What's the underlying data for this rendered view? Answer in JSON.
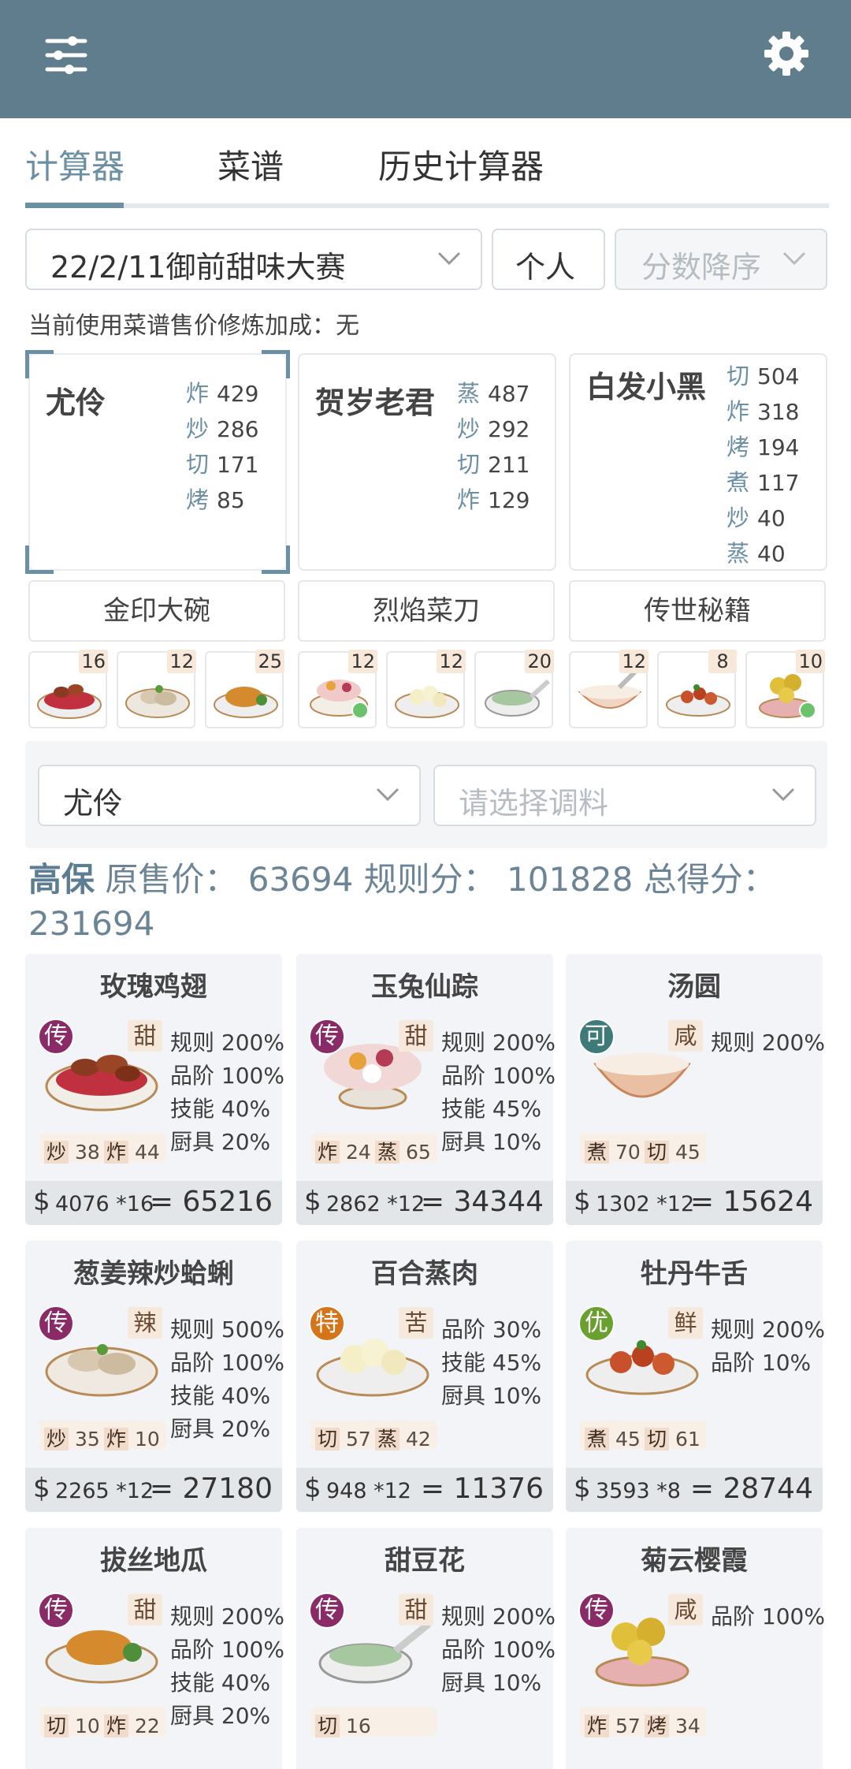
{
  "colors": {
    "header": "#5f7d8d",
    "accent": "#6b8fa3"
  },
  "tabs": [
    "计算器",
    "菜谱",
    "历史计算器"
  ],
  "filters": {
    "contest": "22/2/11御前甜味大赛",
    "mode": "个人",
    "sort": "分数降序"
  },
  "bonus_text": "当前使用菜谱售价修炼加成：无",
  "chefs": [
    {
      "name": "尤伶",
      "skills": [
        [
          "炸",
          "429"
        ],
        [
          "炒",
          "286"
        ],
        [
          "切",
          "171"
        ],
        [
          "烤",
          "85"
        ]
      ]
    },
    {
      "name": "贺岁老君",
      "skills": [
        [
          "蒸",
          "487"
        ],
        [
          "炒",
          "292"
        ],
        [
          "切",
          "211"
        ],
        [
          "炸",
          "129"
        ]
      ]
    },
    {
      "name": "白发小黑",
      "skills": [
        [
          "切",
          "504"
        ],
        [
          "炸",
          "318"
        ],
        [
          "烤",
          "194"
        ],
        [
          "煮",
          "117"
        ],
        [
          "炒",
          "40"
        ],
        [
          "蒸",
          "40"
        ]
      ]
    }
  ],
  "equipment": [
    "金印大碗",
    "烈焰菜刀",
    "传世秘籍"
  ],
  "dish_qty": [
    "16",
    "12",
    "25",
    "12",
    "12",
    "20",
    "12",
    "8",
    "10"
  ],
  "chef_select": "尤伶",
  "condiment_placeholder": "请选择调料",
  "summary": "高保 原售价: 63694 规则分: 101828 总得分: 231694",
  "summary_parts": {
    "tag": "高保",
    "rest": " 原售价： 63694 规则分： 101828 总得分：",
    "total": "231694"
  },
  "dishes": [
    {
      "name": "玫瑰鸡翅",
      "grade": "传",
      "taste": "甜",
      "stats": [
        "规则 200%",
        "品阶 100%",
        "技能 40%",
        "厨具 20%"
      ],
      "req": [
        [
          "炒",
          "38"
        ],
        [
          "炸",
          "44"
        ]
      ],
      "price": "$",
      "calc": "4076 *16",
      "total": "= 65216"
    },
    {
      "name": "玉兔仙踪",
      "grade": "传",
      "taste": "甜",
      "stats": [
        "规则 200%",
        "品阶 100%",
        "技能 45%",
        "厨具 10%"
      ],
      "req": [
        [
          "炸",
          "24"
        ],
        [
          "蒸",
          "65"
        ]
      ],
      "price": "$",
      "calc": "2862 *12",
      "total": "= 34344"
    },
    {
      "name": "汤圆",
      "grade": "可",
      "taste": "咸",
      "stats": [
        "规则 200%"
      ],
      "req": [
        [
          "煮",
          "70"
        ],
        [
          "切",
          "45"
        ]
      ],
      "price": "$",
      "calc": "1302 *12",
      "total": "= 15624"
    },
    {
      "name": "葱姜辣炒蛤蜊",
      "grade": "传",
      "taste": "辣",
      "stats": [
        "规则 500%",
        "品阶 100%",
        "技能 40%",
        "厨具 20%"
      ],
      "req": [
        [
          "炒",
          "35"
        ],
        [
          "炸",
          "10"
        ]
      ],
      "price": "$",
      "calc": "2265 *12",
      "total": "= 27180"
    },
    {
      "name": "百合蒸肉",
      "grade": "特",
      "taste": "苦",
      "stats": [
        "品阶 30%",
        "技能 45%",
        "厨具 10%"
      ],
      "req": [
        [
          "切",
          "57"
        ],
        [
          "蒸",
          "42"
        ]
      ],
      "price": "$",
      "calc": "948 *12",
      "total": "= 11376"
    },
    {
      "name": "牡丹牛舌",
      "grade": "优",
      "taste": "鲜",
      "stats": [
        "规则 200%",
        "品阶 10%"
      ],
      "req": [
        [
          "煮",
          "45"
        ],
        [
          "切",
          "61"
        ]
      ],
      "price": "$",
      "calc": "3593 *8",
      "total": "= 28744"
    },
    {
      "name": "拔丝地瓜",
      "grade": "传",
      "taste": "甜",
      "stats": [
        "规则 200%",
        "品阶 100%",
        "技能 40%",
        "厨具 20%"
      ],
      "req": [
        [
          "切",
          "10"
        ],
        [
          "炸",
          "22"
        ]
      ],
      "price": "$",
      "calc": "",
      "total": ""
    },
    {
      "name": "甜豆花",
      "grade": "传",
      "taste": "甜",
      "stats": [
        "规则 200%",
        "品阶 100%",
        "厨具 10%"
      ],
      "req": [
        [
          "切",
          "16"
        ]
      ],
      "price": "$",
      "calc": "",
      "total": ""
    },
    {
      "name": "菊云樱霞",
      "grade": "传",
      "taste": "咸",
      "stats": [
        "品阶 100%"
      ],
      "req": [
        [
          "炸",
          "57"
        ],
        [
          "烤",
          "34"
        ]
      ],
      "price": "$",
      "calc": "",
      "total": ""
    }
  ]
}
